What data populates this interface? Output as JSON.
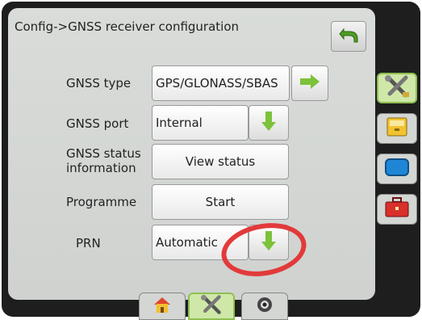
{
  "header": {
    "title": "Config->GNSS receiver configuration"
  },
  "rows": [
    {
      "label": "GNSS type",
      "value": "GPS/GLONASS/SBAS"
    },
    {
      "label": "GNSS port",
      "value": "Internal"
    },
    {
      "label": "GNSS status information",
      "value": "View status"
    },
    {
      "label": "Programme",
      "value": "Start"
    },
    {
      "label": "PRN",
      "value": "Automatic"
    }
  ],
  "colors": {
    "accent_green": "#7cc23a",
    "annotation_red": "#e23a3a",
    "back_arrow_green": "#4f9a24"
  }
}
